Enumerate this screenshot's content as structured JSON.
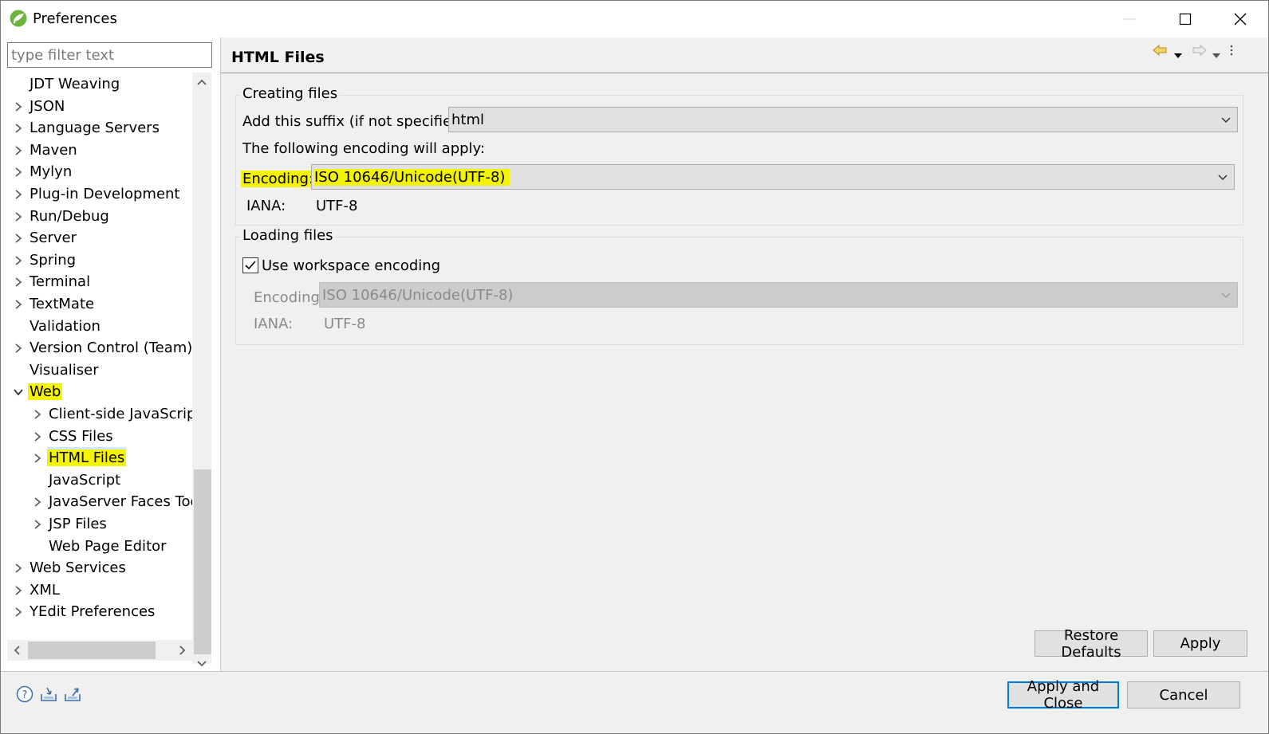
{
  "window": {
    "title": "Preferences"
  },
  "filter": {
    "placeholder": "type filter text"
  },
  "tree": {
    "items": [
      {
        "label": "JDT Weaving",
        "level": 0,
        "expander": "none"
      },
      {
        "label": "JSON",
        "level": 0,
        "expander": "collapsed"
      },
      {
        "label": "Language Servers",
        "level": 0,
        "expander": "collapsed"
      },
      {
        "label": "Maven",
        "level": 0,
        "expander": "collapsed"
      },
      {
        "label": "Mylyn",
        "level": 0,
        "expander": "collapsed"
      },
      {
        "label": "Plug-in Development",
        "level": 0,
        "expander": "collapsed"
      },
      {
        "label": "Run/Debug",
        "level": 0,
        "expander": "collapsed"
      },
      {
        "label": "Server",
        "level": 0,
        "expander": "collapsed"
      },
      {
        "label": "Spring",
        "level": 0,
        "expander": "collapsed"
      },
      {
        "label": "Terminal",
        "level": 0,
        "expander": "collapsed"
      },
      {
        "label": "TextMate",
        "level": 0,
        "expander": "collapsed"
      },
      {
        "label": "Validation",
        "level": 0,
        "expander": "none"
      },
      {
        "label": "Version Control (Team)",
        "level": 0,
        "expander": "collapsed"
      },
      {
        "label": "Visualiser",
        "level": 0,
        "expander": "none"
      },
      {
        "label": "Web",
        "level": 0,
        "expander": "expanded",
        "highlight": true
      },
      {
        "label": "Client-side JavaScript",
        "level": 1,
        "expander": "collapsed"
      },
      {
        "label": "CSS Files",
        "level": 1,
        "expander": "collapsed"
      },
      {
        "label": "HTML Files",
        "level": 1,
        "expander": "collapsed",
        "highlight": true,
        "selected": true
      },
      {
        "label": "JavaScript",
        "level": 1,
        "expander": "none"
      },
      {
        "label": "JavaServer Faces Tools",
        "level": 1,
        "expander": "collapsed"
      },
      {
        "label": "JSP Files",
        "level": 1,
        "expander": "collapsed"
      },
      {
        "label": "Web Page Editor",
        "level": 1,
        "expander": "none"
      },
      {
        "label": "Web Services",
        "level": 0,
        "expander": "collapsed"
      },
      {
        "label": "XML",
        "level": 0,
        "expander": "collapsed"
      },
      {
        "label": "YEdit Preferences",
        "level": 0,
        "expander": "collapsed"
      }
    ]
  },
  "page": {
    "title": "HTML Files",
    "nav_icons": [
      "back-arrow-icon",
      "back-menu-icon",
      "forward-arrow-icon",
      "forward-menu-icon",
      "view-menu-icon"
    ]
  },
  "creating": {
    "group_title": "Creating files",
    "suffix_label": "Add this suffix (if not specified):",
    "suffix_value": "html",
    "encoding_info": "The following encoding will apply:",
    "encoding_label": "Encoding:",
    "encoding_value": "ISO 10646/Unicode(UTF-8)",
    "iana_label": "IANA:",
    "iana_value": "UTF-8"
  },
  "loading": {
    "group_title": "Loading files",
    "use_workspace_label": "Use workspace encoding",
    "use_workspace_checked": true,
    "encoding_label": "Encoding:",
    "encoding_value": "ISO 10646/Unicode(UTF-8)",
    "iana_label": "IANA:",
    "iana_value": "UTF-8"
  },
  "buttons": {
    "restore_defaults": "Restore Defaults",
    "apply": "Apply",
    "apply_and_close": "Apply and Close",
    "cancel": "Cancel"
  },
  "bottom_icons": [
    "help-icon",
    "import-icon",
    "export-icon"
  ],
  "colors": {
    "highlight": "#f4f400",
    "selection": "#cde8ff",
    "default_button_border": "#0078d7"
  }
}
